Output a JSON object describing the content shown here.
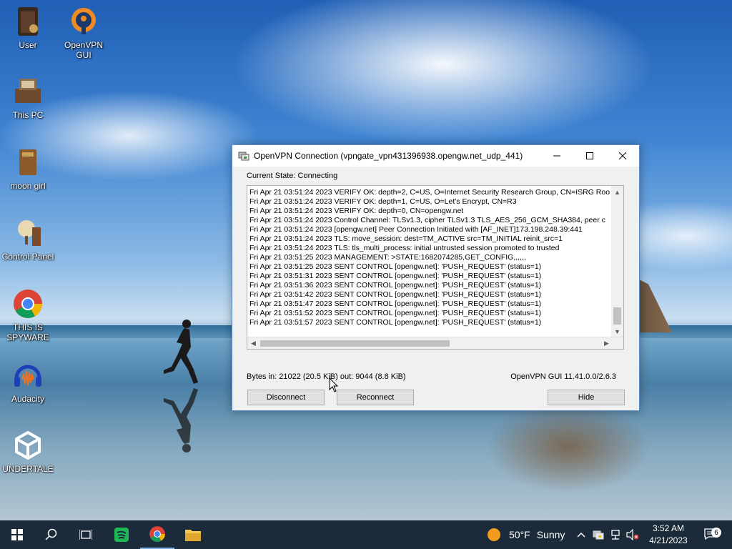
{
  "desktop": {
    "icons": [
      {
        "label": "User",
        "icon": "book-shelf-icon"
      },
      {
        "label": "OpenVPN GUI",
        "icon": "openvpn-icon"
      },
      {
        "label": "This PC",
        "icon": "computer-icon"
      },
      {
        "label": "moon girl",
        "icon": "folder-box-icon"
      },
      {
        "label": "Control Panel",
        "icon": "lamp-icon"
      },
      {
        "label": "THIS IS SPYWARE",
        "icon": "chrome-icon"
      },
      {
        "label": "Audacity",
        "icon": "audacity-icon"
      },
      {
        "label": "UNDERTALE",
        "icon": "unity-icon"
      }
    ]
  },
  "window": {
    "title": "OpenVPN Connection (vpngate_vpn431396938.opengw.net_udp_441)",
    "state": "Current State: Connecting",
    "log": [
      "Fri Apr 21 03:51:24 2023 VERIFY OK: depth=2, C=US, O=Internet Security Research Group, CN=ISRG Roo",
      "Fri Apr 21 03:51:24 2023 VERIFY OK: depth=1, C=US, O=Let's Encrypt, CN=R3",
      "Fri Apr 21 03:51:24 2023 VERIFY OK: depth=0, CN=opengw.net",
      "Fri Apr 21 03:51:24 2023 Control Channel: TLSv1.3, cipher TLSv1.3 TLS_AES_256_GCM_SHA384, peer c",
      "Fri Apr 21 03:51:24 2023 [opengw.net] Peer Connection Initiated with [AF_INET]173.198.248.39:441",
      "Fri Apr 21 03:51:24 2023 TLS: move_session: dest=TM_ACTIVE src=TM_INITIAL reinit_src=1",
      "Fri Apr 21 03:51:24 2023 TLS: tls_multi_process: initial untrusted session promoted to trusted",
      "Fri Apr 21 03:51:25 2023 MANAGEMENT: >STATE:1682074285,GET_CONFIG,,,,,,",
      "Fri Apr 21 03:51:25 2023 SENT CONTROL [opengw.net]: 'PUSH_REQUEST' (status=1)",
      "Fri Apr 21 03:51:31 2023 SENT CONTROL [opengw.net]: 'PUSH_REQUEST' (status=1)",
      "Fri Apr 21 03:51:36 2023 SENT CONTROL [opengw.net]: 'PUSH_REQUEST' (status=1)",
      "Fri Apr 21 03:51:42 2023 SENT CONTROL [opengw.net]: 'PUSH_REQUEST' (status=1)",
      "Fri Apr 21 03:51:47 2023 SENT CONTROL [opengw.net]: 'PUSH_REQUEST' (status=1)",
      "Fri Apr 21 03:51:52 2023 SENT CONTROL [opengw.net]: 'PUSH_REQUEST' (status=1)",
      "Fri Apr 21 03:51:57 2023 SENT CONTROL [opengw.net]: 'PUSH_REQUEST' (status=1)"
    ],
    "bytes": "Bytes in: 21022 (20.5 KiB)  out: 9044 (8.8 KiB)",
    "version": "OpenVPN GUI 11.41.0.0/2.6.3",
    "buttons": {
      "disconnect": "Disconnect",
      "reconnect": "Reconnect",
      "hide": "Hide"
    }
  },
  "taskbar": {
    "weather_temp": "50°F",
    "weather_cond": "Sunny",
    "time": "3:52 AM",
    "date": "4/21/2023",
    "notification_count": "6"
  },
  "colors": {
    "taskbar": "#1c2b3a",
    "window_border": "#5a8bc4"
  }
}
